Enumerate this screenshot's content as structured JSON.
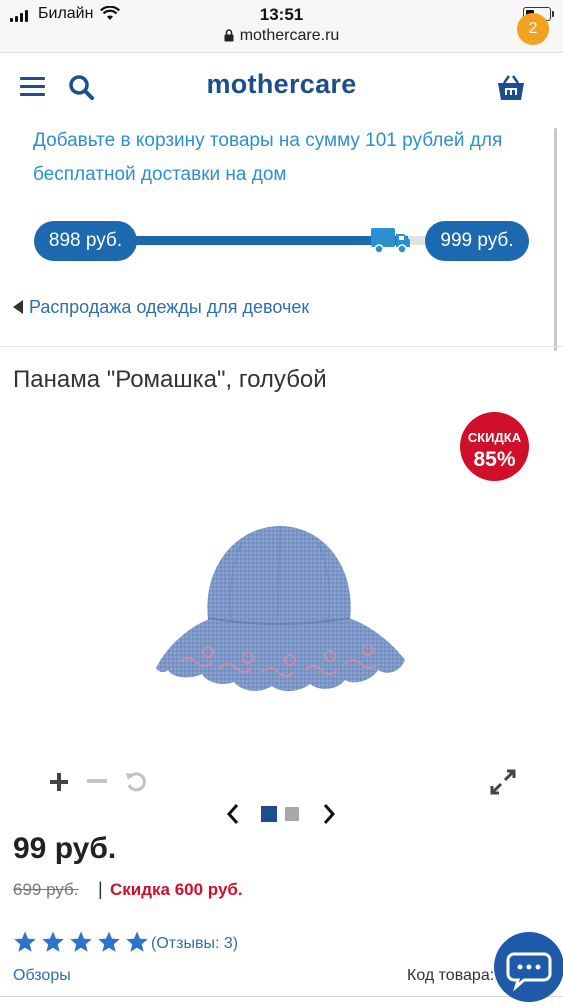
{
  "status_bar": {
    "carrier": "Билайн",
    "time": "13:51",
    "url": "mothercare.ru"
  },
  "header": {
    "logo": "mothercare",
    "cart_count": "2",
    "brand_color": "#1b4f8a",
    "badge_color": "#f3a21f"
  },
  "promo": {
    "text": "Добавьте в корзину товары на сумму 101 рублей для бесплатной доставки на дом",
    "color": "#2d8fd2"
  },
  "delivery_progress": {
    "current": "898 руб.",
    "target": "999 руб.",
    "fill_fraction": 0.9,
    "color": "#1c69b0"
  },
  "breadcrumb": {
    "label": "Распродажа одежды для девочек"
  },
  "product": {
    "title": "Панама \"Ромашка\", голубой",
    "sale_badge_line1": "СКИДКА",
    "sale_badge_line2": "85%",
    "sale_color": "#d0102b",
    "price": "99 руб.",
    "old_price": "699 руб.",
    "separator": "|",
    "discount": "Скидка 600 руб.",
    "rating": 5,
    "rating_max": 5,
    "reviews": "(Отзывы: 3)",
    "reviews_link": "Обзоры",
    "code_label": "Код товара:"
  },
  "gallery": {
    "image_count": 2,
    "active_index": 0,
    "icons": [
      "plus-icon",
      "minus-icon",
      "rotate-icon",
      "fullscreen-icon",
      "chevron-left-icon",
      "chevron-right-icon"
    ]
  },
  "chat": {
    "icon": "chat-icon",
    "color": "#1e5aa8"
  }
}
